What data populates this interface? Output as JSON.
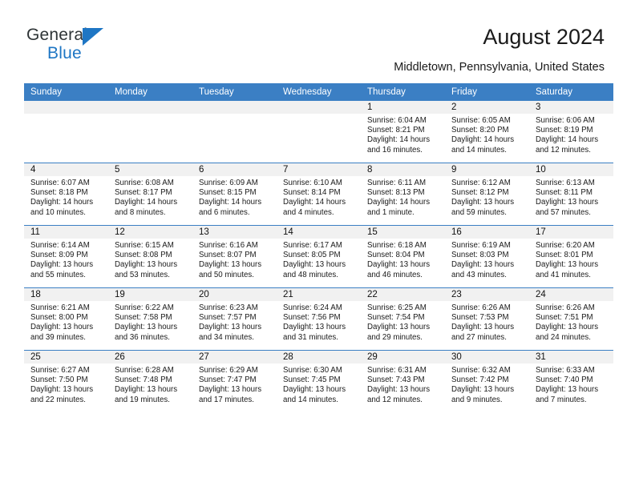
{
  "brand": {
    "name_top": "General",
    "name_bottom": "Blue"
  },
  "header": {
    "title": "August 2024",
    "subtitle": "Middletown, Pennsylvania, United States"
  },
  "colors": {
    "header_blue": "#3b7fc4",
    "brand_blue": "#1e76c4",
    "daynum_band": "#f1f1f1"
  },
  "weekday_headers": [
    "Sunday",
    "Monday",
    "Tuesday",
    "Wednesday",
    "Thursday",
    "Friday",
    "Saturday"
  ],
  "weeks": [
    [
      {
        "day": "",
        "lines": []
      },
      {
        "day": "",
        "lines": []
      },
      {
        "day": "",
        "lines": []
      },
      {
        "day": "",
        "lines": []
      },
      {
        "day": "1",
        "lines": [
          "Sunrise: 6:04 AM",
          "Sunset: 8:21 PM",
          "Daylight: 14 hours",
          "and 16 minutes."
        ]
      },
      {
        "day": "2",
        "lines": [
          "Sunrise: 6:05 AM",
          "Sunset: 8:20 PM",
          "Daylight: 14 hours",
          "and 14 minutes."
        ]
      },
      {
        "day": "3",
        "lines": [
          "Sunrise: 6:06 AM",
          "Sunset: 8:19 PM",
          "Daylight: 14 hours",
          "and 12 minutes."
        ]
      }
    ],
    [
      {
        "day": "4",
        "lines": [
          "Sunrise: 6:07 AM",
          "Sunset: 8:18 PM",
          "Daylight: 14 hours",
          "and 10 minutes."
        ]
      },
      {
        "day": "5",
        "lines": [
          "Sunrise: 6:08 AM",
          "Sunset: 8:17 PM",
          "Daylight: 14 hours",
          "and 8 minutes."
        ]
      },
      {
        "day": "6",
        "lines": [
          "Sunrise: 6:09 AM",
          "Sunset: 8:15 PM",
          "Daylight: 14 hours",
          "and 6 minutes."
        ]
      },
      {
        "day": "7",
        "lines": [
          "Sunrise: 6:10 AM",
          "Sunset: 8:14 PM",
          "Daylight: 14 hours",
          "and 4 minutes."
        ]
      },
      {
        "day": "8",
        "lines": [
          "Sunrise: 6:11 AM",
          "Sunset: 8:13 PM",
          "Daylight: 14 hours",
          "and 1 minute."
        ]
      },
      {
        "day": "9",
        "lines": [
          "Sunrise: 6:12 AM",
          "Sunset: 8:12 PM",
          "Daylight: 13 hours",
          "and 59 minutes."
        ]
      },
      {
        "day": "10",
        "lines": [
          "Sunrise: 6:13 AM",
          "Sunset: 8:11 PM",
          "Daylight: 13 hours",
          "and 57 minutes."
        ]
      }
    ],
    [
      {
        "day": "11",
        "lines": [
          "Sunrise: 6:14 AM",
          "Sunset: 8:09 PM",
          "Daylight: 13 hours",
          "and 55 minutes."
        ]
      },
      {
        "day": "12",
        "lines": [
          "Sunrise: 6:15 AM",
          "Sunset: 8:08 PM",
          "Daylight: 13 hours",
          "and 53 minutes."
        ]
      },
      {
        "day": "13",
        "lines": [
          "Sunrise: 6:16 AM",
          "Sunset: 8:07 PM",
          "Daylight: 13 hours",
          "and 50 minutes."
        ]
      },
      {
        "day": "14",
        "lines": [
          "Sunrise: 6:17 AM",
          "Sunset: 8:05 PM",
          "Daylight: 13 hours",
          "and 48 minutes."
        ]
      },
      {
        "day": "15",
        "lines": [
          "Sunrise: 6:18 AM",
          "Sunset: 8:04 PM",
          "Daylight: 13 hours",
          "and 46 minutes."
        ]
      },
      {
        "day": "16",
        "lines": [
          "Sunrise: 6:19 AM",
          "Sunset: 8:03 PM",
          "Daylight: 13 hours",
          "and 43 minutes."
        ]
      },
      {
        "day": "17",
        "lines": [
          "Sunrise: 6:20 AM",
          "Sunset: 8:01 PM",
          "Daylight: 13 hours",
          "and 41 minutes."
        ]
      }
    ],
    [
      {
        "day": "18",
        "lines": [
          "Sunrise: 6:21 AM",
          "Sunset: 8:00 PM",
          "Daylight: 13 hours",
          "and 39 minutes."
        ]
      },
      {
        "day": "19",
        "lines": [
          "Sunrise: 6:22 AM",
          "Sunset: 7:58 PM",
          "Daylight: 13 hours",
          "and 36 minutes."
        ]
      },
      {
        "day": "20",
        "lines": [
          "Sunrise: 6:23 AM",
          "Sunset: 7:57 PM",
          "Daylight: 13 hours",
          "and 34 minutes."
        ]
      },
      {
        "day": "21",
        "lines": [
          "Sunrise: 6:24 AM",
          "Sunset: 7:56 PM",
          "Daylight: 13 hours",
          "and 31 minutes."
        ]
      },
      {
        "day": "22",
        "lines": [
          "Sunrise: 6:25 AM",
          "Sunset: 7:54 PM",
          "Daylight: 13 hours",
          "and 29 minutes."
        ]
      },
      {
        "day": "23",
        "lines": [
          "Sunrise: 6:26 AM",
          "Sunset: 7:53 PM",
          "Daylight: 13 hours",
          "and 27 minutes."
        ]
      },
      {
        "day": "24",
        "lines": [
          "Sunrise: 6:26 AM",
          "Sunset: 7:51 PM",
          "Daylight: 13 hours",
          "and 24 minutes."
        ]
      }
    ],
    [
      {
        "day": "25",
        "lines": [
          "Sunrise: 6:27 AM",
          "Sunset: 7:50 PM",
          "Daylight: 13 hours",
          "and 22 minutes."
        ]
      },
      {
        "day": "26",
        "lines": [
          "Sunrise: 6:28 AM",
          "Sunset: 7:48 PM",
          "Daylight: 13 hours",
          "and 19 minutes."
        ]
      },
      {
        "day": "27",
        "lines": [
          "Sunrise: 6:29 AM",
          "Sunset: 7:47 PM",
          "Daylight: 13 hours",
          "and 17 minutes."
        ]
      },
      {
        "day": "28",
        "lines": [
          "Sunrise: 6:30 AM",
          "Sunset: 7:45 PM",
          "Daylight: 13 hours",
          "and 14 minutes."
        ]
      },
      {
        "day": "29",
        "lines": [
          "Sunrise: 6:31 AM",
          "Sunset: 7:43 PM",
          "Daylight: 13 hours",
          "and 12 minutes."
        ]
      },
      {
        "day": "30",
        "lines": [
          "Sunrise: 6:32 AM",
          "Sunset: 7:42 PM",
          "Daylight: 13 hours",
          "and 9 minutes."
        ]
      },
      {
        "day": "31",
        "lines": [
          "Sunrise: 6:33 AM",
          "Sunset: 7:40 PM",
          "Daylight: 13 hours",
          "and 7 minutes."
        ]
      }
    ]
  ]
}
